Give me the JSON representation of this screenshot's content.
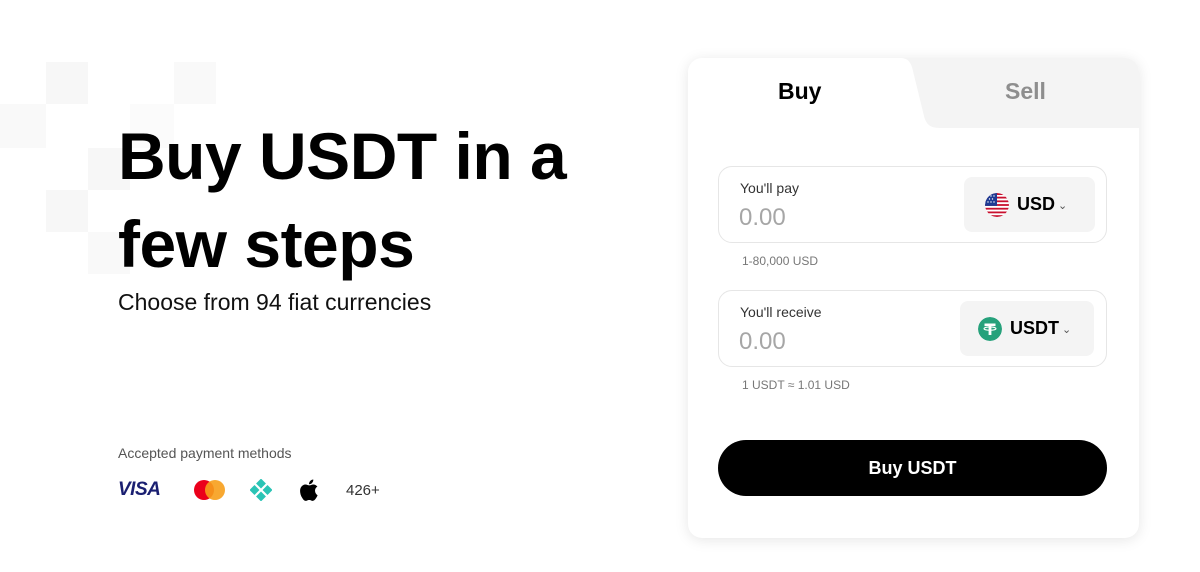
{
  "hero": {
    "title": "Buy USDT in a few steps",
    "subtitle": "Choose from 94 fiat currencies"
  },
  "payment_methods": {
    "label": "Accepted payment methods",
    "items": [
      {
        "name": "VISA",
        "icon": "visa-logo"
      },
      {
        "name": "Mastercard",
        "icon": "mastercard-logo"
      },
      {
        "name": "Diamond",
        "icon": "diamond-logo"
      },
      {
        "name": "Apple Pay",
        "icon": "apple-logo"
      }
    ],
    "more": "426+"
  },
  "tabs": {
    "buy": "Buy",
    "sell": "Sell",
    "active": "buy"
  },
  "pay_field": {
    "label": "You'll pay",
    "placeholder": "0.00",
    "currency": "USD",
    "currency_icon": "us-flag-icon",
    "hint": "1-80,000 USD"
  },
  "receive_field": {
    "label": "You'll receive",
    "placeholder": "0.00",
    "currency": "USDT",
    "currency_icon": "tether-icon",
    "hint": "1 USDT ≈ 1.01 USD"
  },
  "submit_label": "Buy USDT",
  "colors": {
    "tether": "#26a17b",
    "visa": "#1a1f71",
    "mastercard_red": "#eb001b",
    "mastercard_orange": "#f79e1b",
    "diamond": "#2bc4b5",
    "button": "#000000"
  }
}
